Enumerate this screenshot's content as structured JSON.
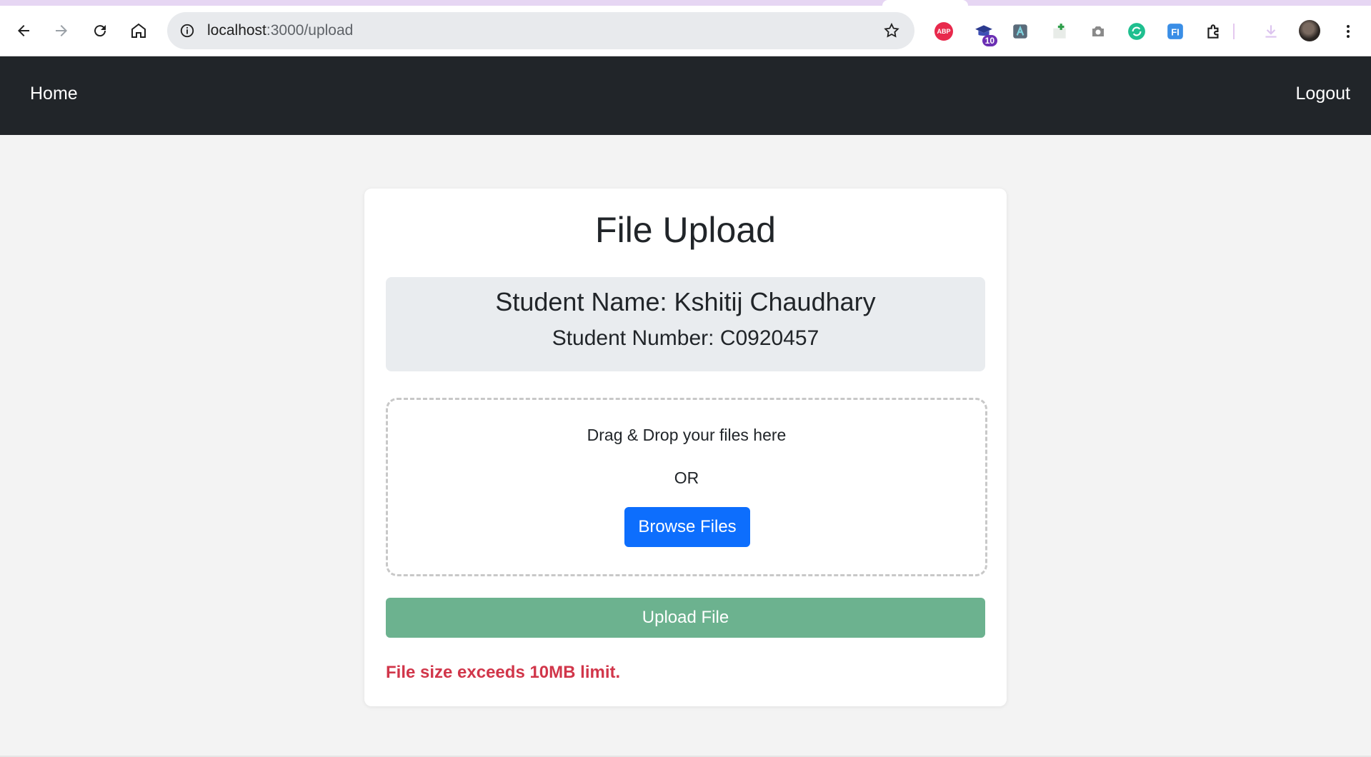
{
  "browser": {
    "url_host": "localhost",
    "url_path": ":3000/upload",
    "extensions": [
      {
        "name": "adblock-plus-icon",
        "label": "ABP"
      },
      {
        "name": "cap-extension-icon",
        "badge": "10"
      }
    ]
  },
  "navbar": {
    "home_label": "Home",
    "logout_label": "Logout"
  },
  "card": {
    "title": "File Upload",
    "student_name": "Student Name: Kshitij Chaudhary",
    "student_number": "Student Number: C0920457"
  },
  "dropzone": {
    "instruction": "Drag & Drop your files here",
    "or_text": "OR",
    "browse_label": "Browse Files"
  },
  "upload": {
    "button_label": "Upload File",
    "error": "File size exceeds 10MB limit."
  },
  "colors": {
    "navbar": "#212529",
    "primary": "#0d6efd",
    "upload_button": "#6cb28f",
    "error": "#d1364a"
  }
}
